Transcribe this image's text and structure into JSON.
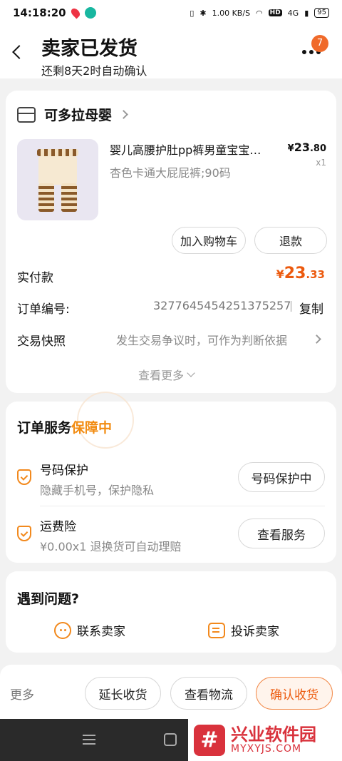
{
  "status_bar": {
    "time": "14:18:20",
    "network_speed": "1.00 KB/S",
    "hd_label": "HD",
    "signal_label": "4G",
    "battery": "95"
  },
  "header": {
    "title": "卖家已发货",
    "subtitle": "还剩8天2时自动确认",
    "badge_count": "7"
  },
  "order": {
    "shop_name": "可多拉母婴",
    "product_title": "婴儿高腰护肚pp裤男童宝宝…",
    "product_variant": "杏色卡通大屁屁裤;90码",
    "price_symbol": "¥",
    "price_main": "23",
    "price_cents": ".80",
    "quantity": "x1",
    "add_cart_label": "加入购物车",
    "refund_label": "退款",
    "paid_label": "实付款",
    "paid_symbol": "¥",
    "paid_main": "23",
    "paid_cents": ".33",
    "order_no_label": "订单编号:",
    "order_no_value": "3277645454251375257",
    "copy_label": "复制",
    "snapshot_label": "交易快照",
    "snapshot_hint": "发生交易争议时，可作为判断依据",
    "view_more_label": "查看更多"
  },
  "service": {
    "title": "订单服务",
    "status": "保障中",
    "items": [
      {
        "name": "号码保护",
        "desc": "隐藏手机号，保护隐私",
        "button": "号码保护中"
      },
      {
        "name": "运费险",
        "desc": "¥0.00x1  退换货可自动理赔",
        "button": "查看服务"
      }
    ]
  },
  "help": {
    "title": "遇到问题?",
    "contact_label": "联系卖家",
    "complain_label": "投诉卖家"
  },
  "bottom": {
    "more_label": "更多",
    "extend_label": "延长收货",
    "logistics_label": "查看物流",
    "confirm_label": "确认收货"
  },
  "watermark": {
    "logo_char": "#",
    "title": "兴业软件园",
    "url": "MYXYJS.COM"
  },
  "colors": {
    "accent_orange": "#ec5a0e",
    "service_orange": "#f28c12",
    "badge": "#f06a2a",
    "watermark_red": "#d9323c"
  }
}
